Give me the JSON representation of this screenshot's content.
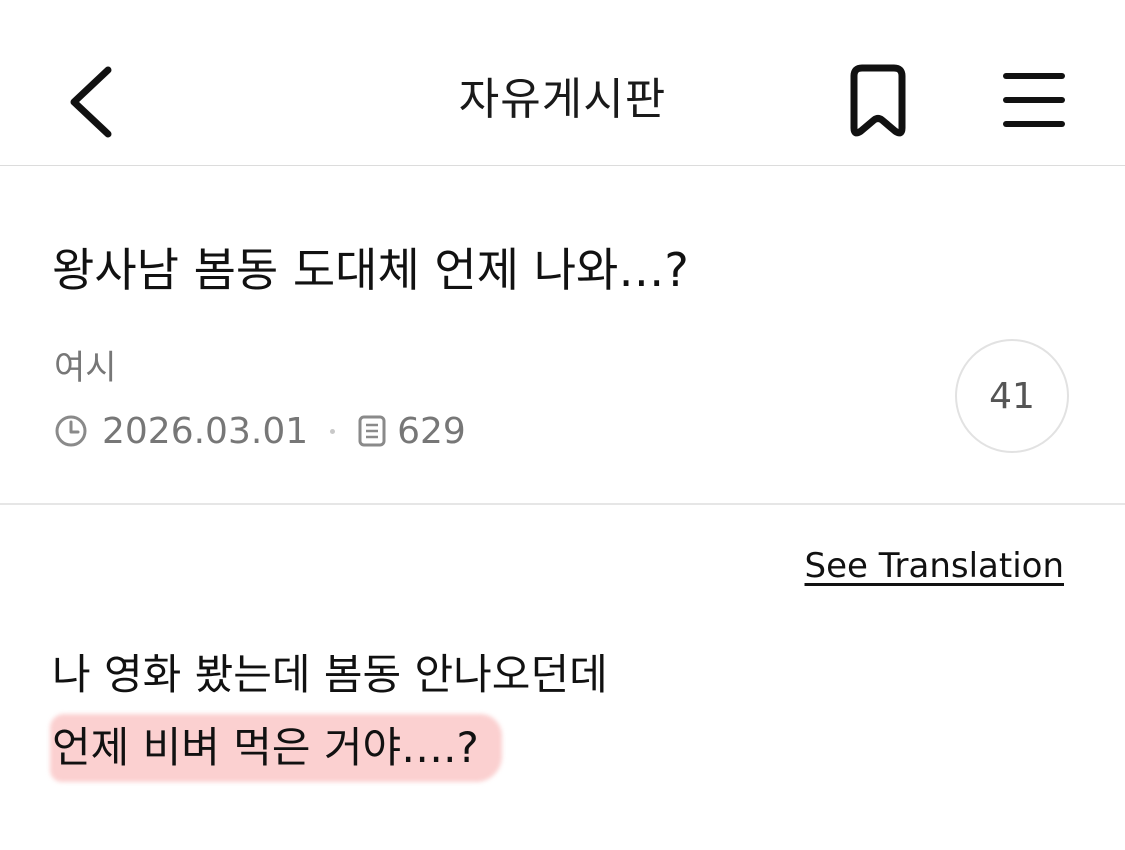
{
  "header": {
    "title": "자유게시판",
    "back_icon": "chevron-left-icon",
    "bookmark_icon": "bookmark-icon",
    "menu_icon": "hamburger-menu-icon"
  },
  "post": {
    "title": "왕사남 봄동 도대체 언제 나와…?",
    "author": "여시",
    "date": "2026.03.01",
    "views": "629",
    "comment_count": "41",
    "see_translation": "See Translation",
    "body_lines": [
      "나 영화 봤는데 봄동 안나오던데",
      "언제 비벼 먹은 거야….?"
    ],
    "highlight_color": "#f8aaaa"
  }
}
